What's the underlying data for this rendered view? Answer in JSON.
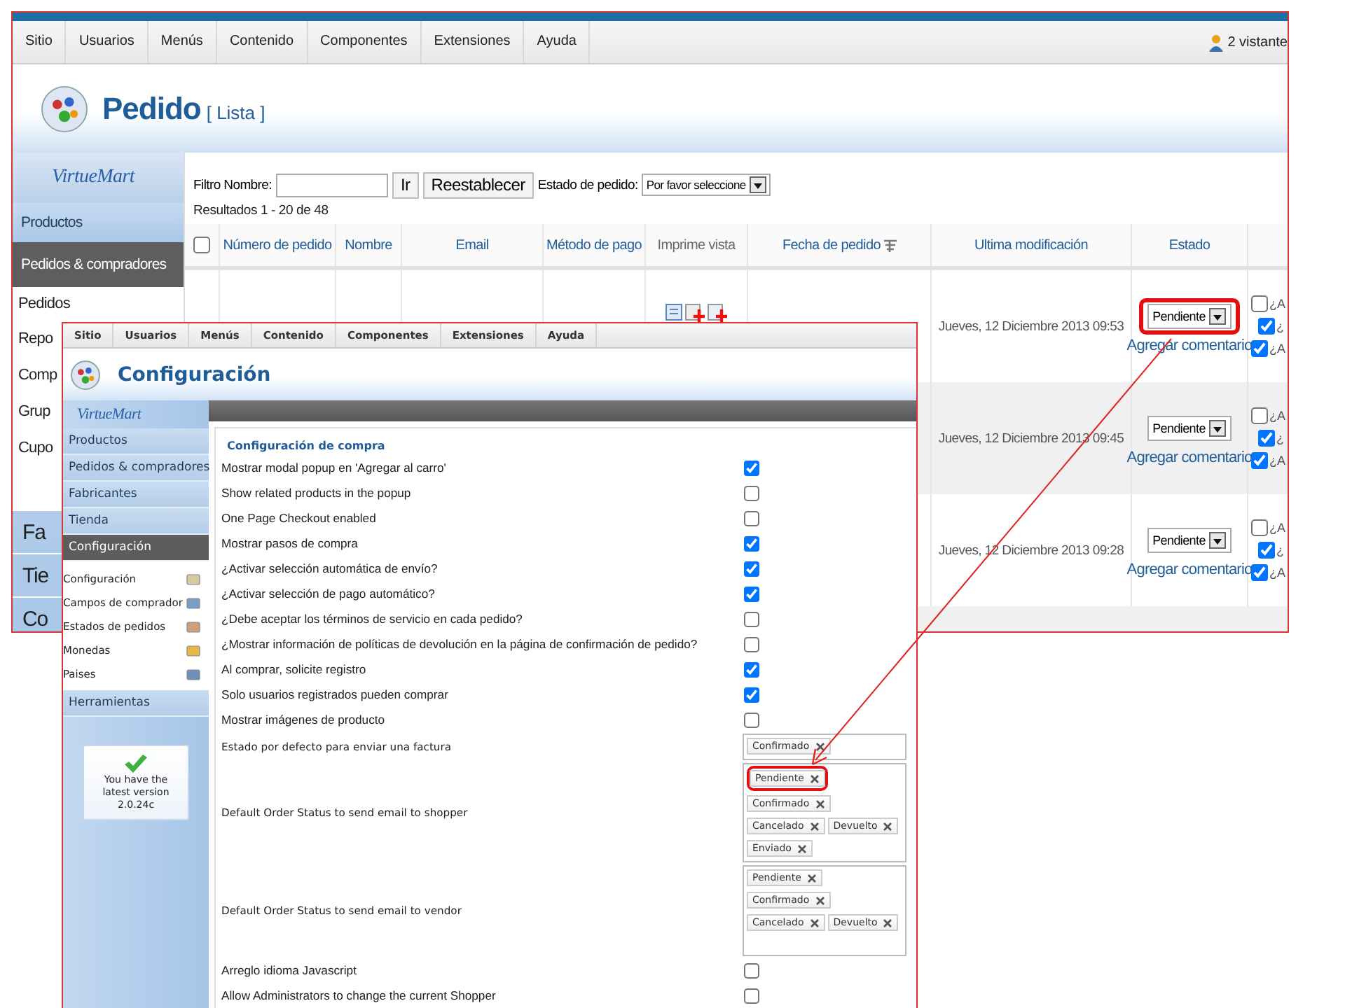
{
  "background_window": {
    "menu": [
      "Sitio",
      "Usuarios",
      "Menús",
      "Contenido",
      "Componentes",
      "Extensiones",
      "Ayuda"
    ],
    "visitors": "2 vistante",
    "title": "Pedido",
    "title_suffix": "[ Lista ]",
    "sidebar": {
      "logo": "VirtueMart",
      "sections": [
        {
          "label": "Productos",
          "selected": false
        },
        {
          "label": "Pedidos & compradores",
          "selected": true
        }
      ],
      "items": [
        "Pedidos",
        "Repo",
        "Comp",
        "Grup",
        "Cupo"
      ],
      "lower_sections": [
        "Fa",
        "Tie",
        "Co"
      ]
    },
    "filter": {
      "name_label": "Filtro Nombre:",
      "go_button": "Ir",
      "reset_button": "Reestablecer",
      "status_label": "Estado de pedido:",
      "status_value": "Por favor seleccione"
    },
    "results": "Resultados 1 - 20 de 48",
    "table": {
      "select_all_checked": false,
      "columns": [
        "Número de pedido",
        "Nombre",
        "Email",
        "Método de pago",
        "Imprime vista",
        "Fecha de pedido",
        "Ultima modificación",
        "Estado"
      ],
      "rows": [
        {
          "modified": "Jueves, 12 Diciembre 2013 09:53",
          "status": "Pendiente",
          "comment_link": "Agregar comentario",
          "highlighted": true,
          "checks": [
            {
              "label": "¿A",
              "checked": false
            },
            {
              "label": "¿",
              "checked": true
            },
            {
              "label": "¿A",
              "checked": true
            }
          ]
        },
        {
          "modified": "Jueves, 12 Diciembre 2013 09:45",
          "status": "Pendiente",
          "comment_link": "Agregar comentario",
          "highlighted": false,
          "checks": [
            {
              "label": "¿A",
              "checked": false
            },
            {
              "label": "¿",
              "checked": true
            },
            {
              "label": "¿A",
              "checked": true
            }
          ]
        },
        {
          "modified": "Jueves, 12 Diciembre 2013 09:28",
          "status": "Pendiente",
          "comment_link": "Agregar comentario",
          "highlighted": false,
          "checks": [
            {
              "label": "¿A",
              "checked": false
            },
            {
              "label": "¿",
              "checked": true
            },
            {
              "label": "¿A",
              "checked": true
            }
          ]
        }
      ]
    }
  },
  "config_window": {
    "menu": [
      "Sitio",
      "Usuarios",
      "Menús",
      "Contenido",
      "Componentes",
      "Extensiones",
      "Ayuda"
    ],
    "title": "Configuración",
    "sidebar": {
      "logo": "VirtueMart",
      "sections": [
        {
          "label": "Productos",
          "selected": false
        },
        {
          "label": "Pedidos & compradores",
          "selected": false
        },
        {
          "label": "Fabricantes",
          "selected": false
        },
        {
          "label": "Tienda",
          "selected": false
        },
        {
          "label": "Configuración",
          "selected": true
        }
      ],
      "items": [
        "Configuración",
        "Campos de comprador",
        "Estados de pedidos",
        "Monedas",
        "Paises"
      ],
      "tools": "Herramientas",
      "version_note": "You have the latest version 2.0.24c"
    },
    "fieldset": "Configuración de compra",
    "rows": [
      {
        "kind": "checkbox",
        "label": "Mostrar modal popup en 'Agregar al carro'",
        "checked": true
      },
      {
        "kind": "checkbox",
        "label": "Show related products in the popup",
        "checked": false
      },
      {
        "kind": "checkbox",
        "label": "One Page Checkout enabled",
        "checked": false
      },
      {
        "kind": "checkbox",
        "label": "Mostrar pasos de compra",
        "checked": true
      },
      {
        "kind": "checkbox",
        "label": "¿Activar selección automática de envío?",
        "checked": true
      },
      {
        "kind": "checkbox",
        "label": "¿Activar selección de pago automático?",
        "checked": true
      },
      {
        "kind": "checkbox",
        "label": "¿Debe aceptar los términos de servicio en cada pedido?",
        "checked": false
      },
      {
        "kind": "checkbox",
        "label": "¿Mostrar información de políticas de devolución en la página de confirmación de pedido?",
        "checked": false
      },
      {
        "kind": "checkbox",
        "label": "Al comprar, solicite registro",
        "checked": true
      },
      {
        "kind": "checkbox",
        "label": "Solo usuarios registrados pueden comprar",
        "checked": true
      },
      {
        "kind": "checkbox",
        "label": "Mostrar imágenes de producto",
        "checked": false
      },
      {
        "kind": "tags",
        "label": "Estado por defecto para enviar una factura",
        "tags": [
          {
            "label": "Confirmado",
            "highlighted": false
          }
        ]
      },
      {
        "kind": "tags",
        "label": "Default Order Status to send email to shopper",
        "tags": [
          {
            "label": "Pendiente",
            "highlighted": true
          },
          {
            "label": "Confirmado",
            "highlighted": false
          },
          {
            "label": "Cancelado",
            "highlighted": false
          },
          {
            "label": "Devuelto",
            "highlighted": false
          },
          {
            "label": "Enviado",
            "highlighted": false
          }
        ]
      },
      {
        "kind": "tags",
        "label": "Default Order Status to send email to vendor",
        "tags": [
          {
            "label": "Pendiente",
            "highlighted": false
          },
          {
            "label": "Confirmado",
            "highlighted": false
          },
          {
            "label": "Cancelado",
            "highlighted": false
          },
          {
            "label": "Devuelto",
            "highlighted": false
          }
        ]
      },
      {
        "kind": "checkbox",
        "label": "Arreglo idioma Javascript",
        "checked": false
      },
      {
        "kind": "checkbox",
        "label": "Allow Administrators to change the current Shopper",
        "checked": false
      }
    ]
  }
}
